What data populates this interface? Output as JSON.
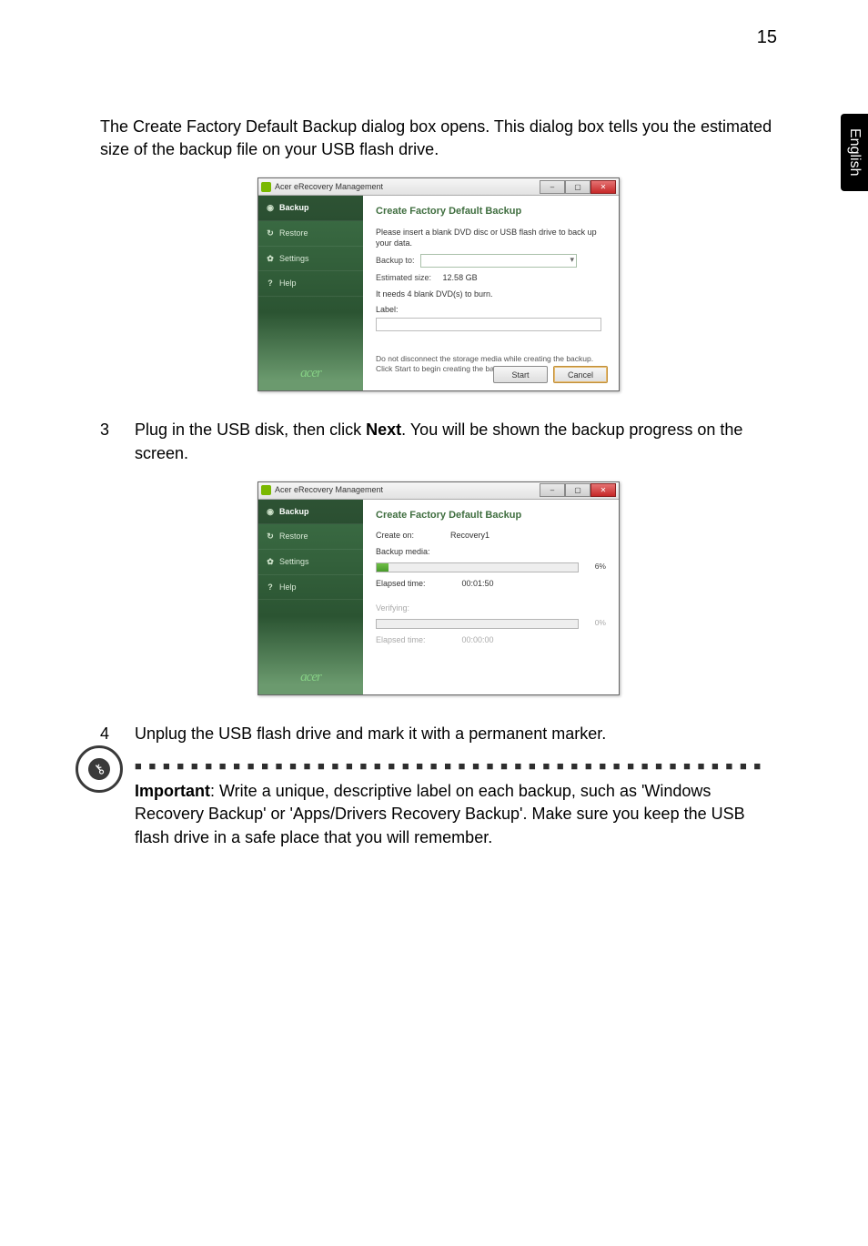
{
  "page_number": "15",
  "side_tab": "English",
  "intro_para": "The Create Factory Default Backup dialog box opens. This dialog box tells you the estimated size of the backup file on your USB flash drive.",
  "dialog1": {
    "app_title": "Acer eRecovery Management",
    "sidebar": {
      "backup": "Backup",
      "restore": "Restore",
      "settings": "Settings",
      "help": "Help",
      "logo": "acer"
    },
    "panel_title": "Create Factory Default Backup",
    "instruction": "Please insert a blank DVD disc or USB flash drive to back up your data.",
    "backup_to_label": "Backup to:",
    "estimated_size_label": "Estimated size:",
    "estimated_size_value": "12.58 GB",
    "needs_dvd": "It needs 4 blank DVD(s) to burn.",
    "label_label": "Label:",
    "hint1": "Do not disconnect the storage media while creating the backup.",
    "hint2": "Click Start to begin creating the backup.",
    "start_btn": "Start",
    "cancel_btn": "Cancel"
  },
  "step3": {
    "num": "3",
    "text_before": "Plug in the USB disk, then click ",
    "bold": "Next",
    "text_after": ". You will be shown the backup progress on the screen."
  },
  "dialog2": {
    "app_title": "Acer eRecovery Management",
    "panel_title": "Create Factory Default Backup",
    "create_on_label": "Create on:",
    "create_on_value": "Recovery1",
    "backup_media_label": "Backup media:",
    "progress1_pct": "6%",
    "elapsed1_label": "Elapsed time:",
    "elapsed1_value": "00:01:50",
    "verifying_label": "Verifying:",
    "progress2_pct": "0%",
    "elapsed2_label": "Elapsed time:",
    "elapsed2_value": "00:00:00"
  },
  "step4": {
    "num": "4",
    "text": "Unplug the USB flash drive and mark it with a permanent marker."
  },
  "callout": {
    "dots": "■ ■ ■ ■ ■ ■ ■ ■ ■ ■ ■ ■ ■ ■ ■ ■ ■ ■ ■ ■ ■ ■ ■ ■ ■ ■ ■ ■ ■ ■ ■ ■ ■ ■ ■ ■ ■ ■ ■ ■ ■ ■ ■ ■ ■",
    "bold": "Important",
    "text": ": Write a unique, descriptive label on each backup, such as 'Windows Recovery Backup' or 'Apps/Drivers Recovery Backup'. Make sure you keep the USB flash drive in a safe place that you will remember."
  }
}
